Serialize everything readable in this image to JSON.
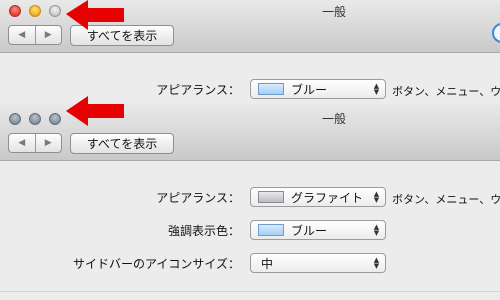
{
  "colors": {
    "arrow": "#e60000",
    "close": "#ee4b43",
    "minimize": "#f7b92b",
    "graphite_light": "#8b97a2"
  },
  "top_window": {
    "title": "一般",
    "nav_back": "◀",
    "nav_forward": "▶",
    "show_all": "すべてを表示",
    "appearance_label": "アピアランス：",
    "appearance_value": "ブルー",
    "appearance_desc": "ボタン、メニュー、ウ"
  },
  "bottom_window": {
    "title": "一般",
    "nav_back": "◀",
    "nav_forward": "▶",
    "show_all": "すべてを表示",
    "appearance_label": "アピアランス：",
    "appearance_value": "グラファイト",
    "appearance_desc": "ボタン、メニュー、ウ",
    "highlight_label": "強調表示色：",
    "highlight_value": "ブルー",
    "icon_size_label": "サイドバーのアイコンサイズ：",
    "icon_size_value": "中"
  },
  "icons": {
    "updown": "▲▼"
  }
}
